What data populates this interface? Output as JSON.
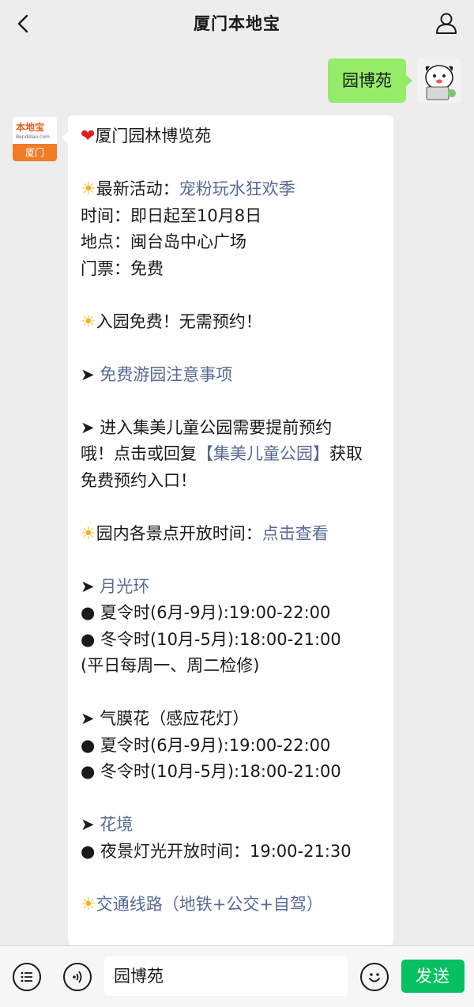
{
  "header": {
    "title": "厦门本地宝"
  },
  "outgoing": {
    "text": "园博苑"
  },
  "bot_avatar": {
    "brand": "本地宝",
    "url": "Bendibao.com",
    "city": "厦门"
  },
  "message": {
    "title": "厦门园林博览苑",
    "activity_label": "最新活动：",
    "activity_link": "宠粉玩水狂欢季",
    "time": "时间：即日起至10月8日",
    "place": "地点：闽台岛中心广场",
    "ticket": "门票：免费",
    "free_entry": "入园免费！无需预约！",
    "tips_link": "免费游园注意事项",
    "jimei_1": "进入集美儿童公园需要提前预约",
    "jimei_2_a": "哦！点击或回复",
    "jimei_2_link": "【集美儿童公园】",
    "jimei_2_b": "获取",
    "jimei_3": "免费预约入口！",
    "hours_label": "园内各景点开放时间：",
    "hours_link": "点击查看",
    "moon_link": "月光环",
    "moon_summer": "夏令时(6月-9月):19:00-22:00",
    "moon_winter": "冬令时(10月-5月):18:00-21:00",
    "moon_note": "(平日每周一、周二检修)",
    "flower_title": "气膜花（感应花灯）",
    "flower_summer": "夏令时(6月-9月):19:00-22:00",
    "flower_winter": "冬令时(10月-5月):18:00-21:00",
    "huajing_link": "花境",
    "huajing_hours": "夜景灯光开放时间：19:00-21:30",
    "traffic_link": "交通线路（地铁+公交+自驾）"
  },
  "input": {
    "value": "园博苑",
    "send_label": "发送"
  },
  "icons": {
    "back": "chevron-left-icon",
    "user": "user-icon",
    "menu": "list-menu-icon",
    "voice": "voice-icon",
    "emoji": "emoji-icon",
    "heart": "heart-emoji",
    "sun": "sun-emoji"
  },
  "colors": {
    "link": "#576b95",
    "send": "#07c160",
    "bubble_out": "#95ec69",
    "brand": "#f07c28"
  }
}
